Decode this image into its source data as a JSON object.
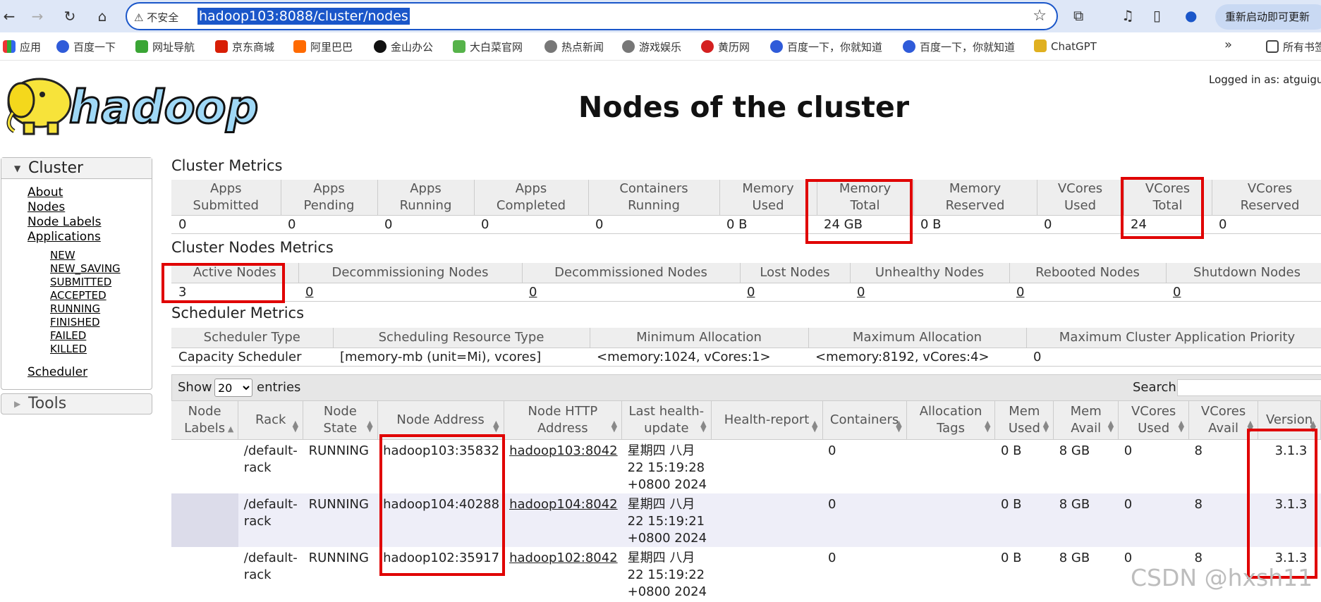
{
  "browser": {
    "security_label": "不安全",
    "url": "hadoop103:8088/cluster/nodes",
    "restart_label": "重新启动即可更新",
    "bookmarks": [
      "应用",
      "百度一下",
      "网址导航",
      "京东商城",
      "阿里巴巴",
      "金山办公",
      "大白菜官网",
      "热点新闻",
      "游戏娱乐",
      "黄历网",
      "百度一下，你就知道",
      "百度一下，你就知道",
      "ChatGPT"
    ],
    "more_label": "»",
    "all_bookmarks_label": "所有书签"
  },
  "page": {
    "logo_text": "hadoop",
    "title": "Nodes of the cluster",
    "logged_in": "Logged in as: atguigu"
  },
  "sidebar": {
    "cluster_label": "Cluster",
    "links": [
      "About",
      "Nodes",
      "Node Labels",
      "Applications"
    ],
    "app_states": [
      "NEW",
      "NEW_SAVING",
      "SUBMITTED",
      "ACCEPTED",
      "RUNNING",
      "FINISHED",
      "FAILED",
      "KILLED"
    ],
    "scheduler_label": "Scheduler",
    "tools_label": "Tools"
  },
  "cluster_metrics": {
    "title": "Cluster Metrics",
    "headers": [
      [
        "Apps",
        "Submitted"
      ],
      [
        "Apps",
        "Pending"
      ],
      [
        "Apps",
        "Running"
      ],
      [
        "Apps",
        "Completed"
      ],
      [
        "Containers",
        "Running"
      ],
      [
        "Memory",
        "Used"
      ],
      [
        "Memory",
        "Total"
      ],
      [
        "Memory",
        "Reserved"
      ],
      [
        "VCores",
        "Used"
      ],
      [
        "VCores",
        "Total"
      ],
      [
        "VCores",
        "Reserved"
      ]
    ],
    "values": [
      "0",
      "0",
      "0",
      "0",
      "0",
      "0 B",
      "24 GB",
      "0 B",
      "0",
      "24",
      "0"
    ]
  },
  "nodes_metrics": {
    "title": "Cluster Nodes Metrics",
    "headers": [
      "Active Nodes",
      "Decommissioning Nodes",
      "Decommissioned Nodes",
      "Lost Nodes",
      "Unhealthy Nodes",
      "Rebooted Nodes",
      "Shutdown Nodes"
    ],
    "values": [
      "3",
      "0",
      "0",
      "0",
      "0",
      "0",
      "0"
    ]
  },
  "scheduler_metrics": {
    "title": "Scheduler Metrics",
    "headers": [
      "Scheduler Type",
      "Scheduling Resource Type",
      "Minimum Allocation",
      "Maximum Allocation",
      "Maximum Cluster Application Priority"
    ],
    "values": [
      "Capacity Scheduler",
      "[memory-mb (unit=Mi), vcores]",
      "<memory:1024, vCores:1>",
      "<memory:8192, vCores:4>",
      "0"
    ]
  },
  "datatable": {
    "show_label": "Show",
    "page_size": "20",
    "entries_label": "entries",
    "search_label": "Search:",
    "headers": [
      [
        "Node",
        "Labels"
      ],
      [
        "Rack"
      ],
      [
        "Node",
        "State"
      ],
      [
        "Node Address"
      ],
      [
        "Node HTTP",
        "Address"
      ],
      [
        "Last health-",
        "update"
      ],
      [
        "Health-report"
      ],
      [
        "Containers"
      ],
      [
        "Allocation",
        "Tags"
      ],
      [
        "Mem",
        "Used"
      ],
      [
        "Mem",
        "Avail"
      ],
      [
        "VCores",
        "Used"
      ],
      [
        "VCores",
        "Avail"
      ],
      [
        "Version"
      ]
    ],
    "rows": [
      {
        "rack": [
          "/default-",
          "rack"
        ],
        "state": "RUNNING",
        "address": "hadoop103:35832",
        "http": "hadoop103:8042",
        "health_update": [
          "星期四 八月",
          "22 15:19:28",
          "+0800 2024"
        ],
        "containers": "0",
        "mem_used": "0 B",
        "mem_avail": "8 GB",
        "vcores_used": "0",
        "vcores_avail": "8",
        "version": "3.1.3"
      },
      {
        "rack": [
          "/default-",
          "rack"
        ],
        "state": "RUNNING",
        "address": "hadoop104:40288",
        "http": "hadoop104:8042",
        "health_update": [
          "星期四 八月",
          "22 15:19:21",
          "+0800 2024"
        ],
        "containers": "0",
        "mem_used": "0 B",
        "mem_avail": "8 GB",
        "vcores_used": "0",
        "vcores_avail": "8",
        "version": "3.1.3"
      },
      {
        "rack": [
          "/default-",
          "rack"
        ],
        "state": "RUNNING",
        "address": "hadoop102:35917",
        "http": "hadoop102:8042",
        "health_update": [
          "星期四 八月",
          "22 15:19:22",
          "+0800 2024"
        ],
        "containers": "0",
        "mem_used": "0 B",
        "mem_avail": "8 GB",
        "vcores_used": "0",
        "vcores_avail": "8",
        "version": "3.1.3"
      }
    ]
  },
  "watermark": "CSDN @hxsh11",
  "colors": {
    "highlight": "#e00000",
    "url_selection": "#1a56c9",
    "logo_blue": "#9fd8f6"
  }
}
